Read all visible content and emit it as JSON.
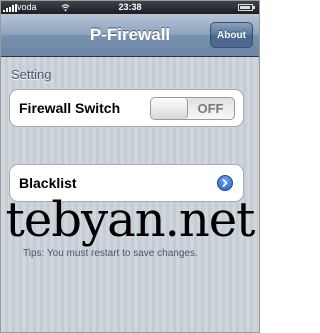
{
  "status_bar": {
    "carrier": "voda",
    "time": "23:38",
    "battery_level": 0.9
  },
  "nav": {
    "title": "P-Firewall",
    "about_label": "About"
  },
  "settings": {
    "section_title": "Setting",
    "firewall_switch_label": "Firewall Switch",
    "firewall_switch_state": "OFF",
    "blacklist_label": "Blacklist"
  },
  "tips": "Tips: You must restart to save changes.",
  "watermark": "tebyan.net",
  "icons": {
    "signal": "signal-bars-icon",
    "wifi": "wifi-icon",
    "battery": "battery-icon",
    "disclosure": "disclosure-arrow-icon"
  },
  "colors": {
    "navbar": "#7890ae",
    "background": "#c5ccd4",
    "disclosure": "#2a63c9"
  }
}
